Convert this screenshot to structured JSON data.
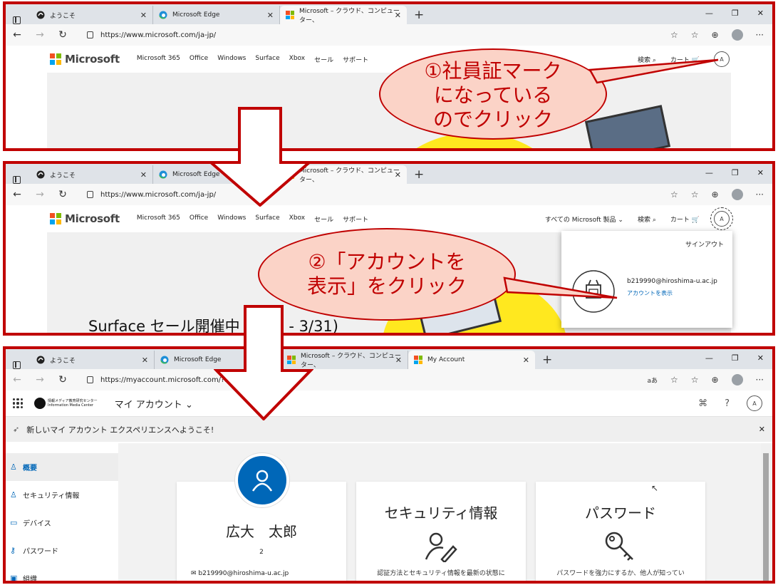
{
  "tabs": {
    "tab1": "ようこそ",
    "tab2": "Microsoft Edge",
    "tab3": "Microsoft – クラウド、コンピューター、",
    "tab4": "My Account"
  },
  "url": {
    "microsoft": "https://www.microsoft.com/ja-jp/",
    "myaccount": "https://myaccount.microsoft.com/?ref=Me"
  },
  "ms_header": {
    "brand": "Microsoft",
    "nav": [
      "Microsoft 365",
      "Office",
      "Windows",
      "Surface",
      "Xbox",
      "セール",
      "サポート"
    ],
    "all_products": "すべての Microsoft 製品",
    "search": "検索",
    "cart": "カート"
  },
  "callouts": {
    "c1_line1": "①社員証マーク",
    "c1_line2": "になっている",
    "c1_line3": "のでクリック",
    "c2_line1": "②「アカウントを",
    "c2_line2": "表示」をクリック"
  },
  "popup": {
    "signout": "サインアウト",
    "email": "b219990@hiroshima-u.ac.jp",
    "view_account": "アカウントを表示"
  },
  "hero": {
    "headline": "Surface セール開催中 (2/18 - 3/31)"
  },
  "myaccount": {
    "org_logo_jp": "情報メディア教育研究センター",
    "org_logo_en": "Information Media Center",
    "app_title": "マイ アカウント",
    "welcome": "新しいマイ アカウント エクスペリエンスへようこそ!",
    "aa_label": "aあ",
    "sidebar": [
      "概要",
      "セキュリティ情報",
      "デバイス",
      "パスワード",
      "組織"
    ],
    "user_name": "広大　太郎",
    "user_number": "2",
    "user_email": "b219990@hiroshima-u.ac.jp",
    "security_title": "セキュリティ情報",
    "security_desc": "認証方法とセキュリティ情報を最新の状態に",
    "password_title": "パスワード",
    "password_desc": "パスワードを強力にするか、他人が知ってい"
  },
  "colors": {
    "callout_red": "#c00000",
    "callout_fill": "#fbd3c7",
    "ms_blue": "#0067b8"
  }
}
